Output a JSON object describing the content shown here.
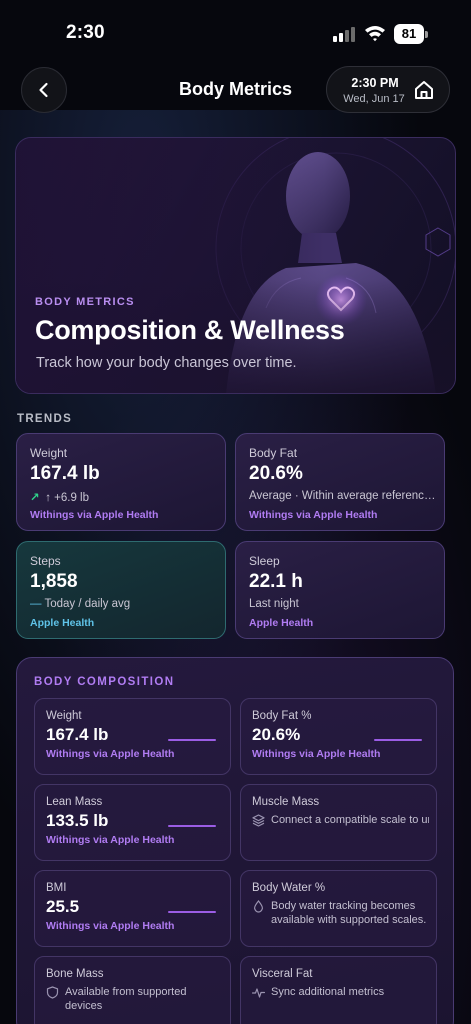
{
  "status_bar": {
    "time": "2:30",
    "battery": "81"
  },
  "nav": {
    "title": "Body Metrics",
    "pill_time": "2:30 PM",
    "pill_date": "Wed, Jun 17"
  },
  "hero": {
    "eyebrow": "BODY METRICS",
    "title": "Composition & Wellness",
    "subtitle": "Track how your body changes over time."
  },
  "trends": {
    "label": "TRENDS",
    "cards": [
      {
        "label": "Weight",
        "value": "167.4 lb",
        "sub": "↑ +6.9 lb",
        "source": "Withings via Apple Health"
      },
      {
        "label": "Body Fat",
        "value": "20.6%",
        "sub": "Average · Within average reference range",
        "source": "Withings via Apple Health"
      },
      {
        "label": "Steps",
        "value": "1,858",
        "sub": "Today / daily avg",
        "source": "Apple Health"
      },
      {
        "label": "Sleep",
        "value": "22.1 h",
        "sub": "Last night",
        "source": "Apple Health"
      }
    ]
  },
  "composition": {
    "title": "BODY COMPOSITION",
    "weight": {
      "label": "Weight",
      "value": "167.4 lb",
      "source": "Withings via Apple Health"
    },
    "body_fat": {
      "label": "Body Fat %",
      "value": "20.6%",
      "source": "Withings via Apple Health"
    },
    "lean_mass": {
      "label": "Lean Mass",
      "value": "133.5 lb",
      "source": "Withings via Apple Health"
    },
    "muscle_mass": {
      "label": "Muscle Mass",
      "note": "Connect a compatible scale to unlock muscle measurements."
    },
    "bmi": {
      "label": "BMI",
      "value": "25.5",
      "source": "Withings via Apple Health"
    },
    "body_water": {
      "label": "Body Water %",
      "note": "Body water tracking becomes available with supported scales."
    },
    "bone_mass": {
      "label": "Bone Mass",
      "note": "Available from supported devices"
    },
    "visceral_fat": {
      "label": "Visceral Fat",
      "note": "Sync additional metrics"
    }
  },
  "colors": {
    "accent": "#b07cf2",
    "teal": "#5fc3e8",
    "trend_up": "#2fd28a"
  }
}
